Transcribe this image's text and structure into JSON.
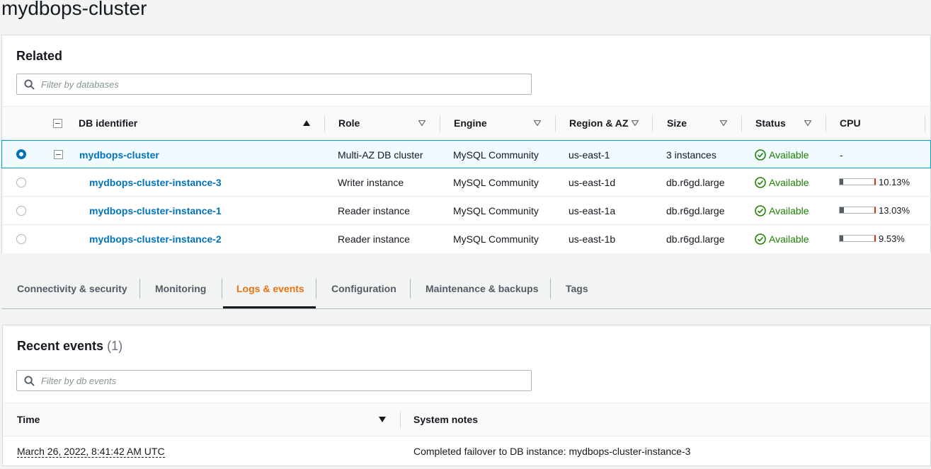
{
  "page": {
    "title": "mydbops-cluster"
  },
  "related": {
    "heading": "Related",
    "filter_placeholder": "Filter by databases",
    "columns": {
      "identifier": "DB identifier",
      "role": "Role",
      "engine": "Engine",
      "region": "Region & AZ",
      "size": "Size",
      "status": "Status",
      "cpu": "CPU"
    },
    "rows": [
      {
        "identifier": "mydbops-cluster",
        "role": "Multi-AZ DB cluster",
        "engine": "MySQL Community",
        "region": "us-east-1",
        "size": "3 instances",
        "status": "Available",
        "cpu_text": "-",
        "selected": true
      },
      {
        "identifier": "mydbops-cluster-instance-3",
        "role": "Writer instance",
        "engine": "MySQL Community",
        "region": "us-east-1d",
        "size": "db.r6gd.large",
        "status": "Available",
        "cpu_text": "10.13%",
        "cpu_value": 10.13
      },
      {
        "identifier": "mydbops-cluster-instance-1",
        "role": "Reader instance",
        "engine": "MySQL Community",
        "region": "us-east-1a",
        "size": "db.r6gd.large",
        "status": "Available",
        "cpu_text": "13.03%",
        "cpu_value": 13.03
      },
      {
        "identifier": "mydbops-cluster-instance-2",
        "role": "Reader instance",
        "engine": "MySQL Community",
        "region": "us-east-1b",
        "size": "db.r6gd.large",
        "status": "Available",
        "cpu_text": "9.53%",
        "cpu_value": 9.53
      }
    ]
  },
  "tabs": [
    {
      "label": "Connectivity & security"
    },
    {
      "label": "Monitoring"
    },
    {
      "label": "Logs & events",
      "active": true
    },
    {
      "label": "Configuration"
    },
    {
      "label": "Maintenance & backups"
    },
    {
      "label": "Tags"
    }
  ],
  "events": {
    "heading": "Recent events",
    "count": "(1)",
    "filter_placeholder": "Filter by db events",
    "columns": {
      "time": "Time",
      "notes": "System notes"
    },
    "rows": [
      {
        "time": "March 26, 2022, 8:41:42 AM UTC",
        "notes": "Completed failover to DB instance: mydbops-cluster-instance-3"
      }
    ]
  },
  "colors": {
    "link": "#0073bb",
    "success": "#1d8102",
    "active_tab": "#ec7211",
    "selected_row_border": "#00a1c9"
  },
  "icons": {
    "search": "search-icon",
    "status": "check-circle-icon",
    "sort_asc": "sort-ascending-icon",
    "sort": "sort-icon",
    "expand": "collapse-icon"
  }
}
